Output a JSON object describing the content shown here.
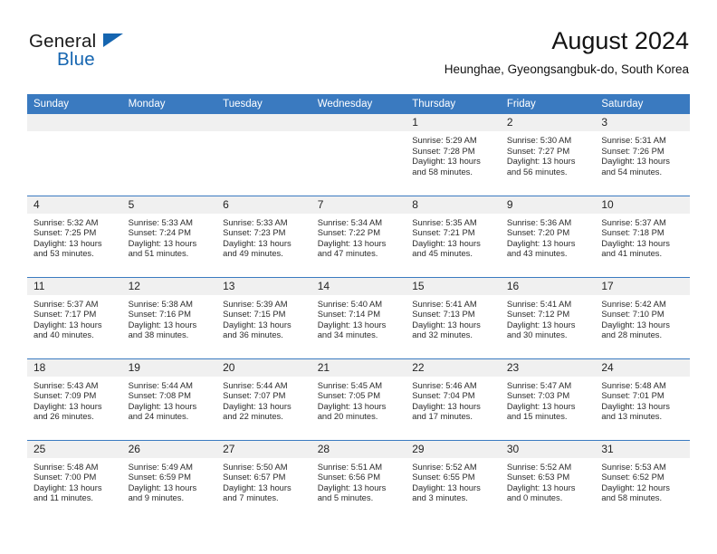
{
  "brand": {
    "name_part1": "General",
    "name_part2": "Blue",
    "accent_color": "#1565b0",
    "logo_icon": "triangle-logo-icon"
  },
  "header": {
    "title": "August 2024",
    "subtitle": "Heunghae, Gyeongsangbuk-do, South Korea"
  },
  "calendar": {
    "header_bg": "#3a7ac0",
    "daynum_bg": "#f0f0f0",
    "weekday_headers": [
      "Sunday",
      "Monday",
      "Tuesday",
      "Wednesday",
      "Thursday",
      "Friday",
      "Saturday"
    ],
    "weeks": [
      [
        {
          "day": "",
          "sunrise": "",
          "sunset": "",
          "daylight_line1": "",
          "daylight_line2": "",
          "empty": true
        },
        {
          "day": "",
          "sunrise": "",
          "sunset": "",
          "daylight_line1": "",
          "daylight_line2": "",
          "empty": true
        },
        {
          "day": "",
          "sunrise": "",
          "sunset": "",
          "daylight_line1": "",
          "daylight_line2": "",
          "empty": true
        },
        {
          "day": "",
          "sunrise": "",
          "sunset": "",
          "daylight_line1": "",
          "daylight_line2": "",
          "empty": true
        },
        {
          "day": "1",
          "sunrise": "Sunrise: 5:29 AM",
          "sunset": "Sunset: 7:28 PM",
          "daylight_line1": "Daylight: 13 hours",
          "daylight_line2": "and 58 minutes."
        },
        {
          "day": "2",
          "sunrise": "Sunrise: 5:30 AM",
          "sunset": "Sunset: 7:27 PM",
          "daylight_line1": "Daylight: 13 hours",
          "daylight_line2": "and 56 minutes."
        },
        {
          "day": "3",
          "sunrise": "Sunrise: 5:31 AM",
          "sunset": "Sunset: 7:26 PM",
          "daylight_line1": "Daylight: 13 hours",
          "daylight_line2": "and 54 minutes."
        }
      ],
      [
        {
          "day": "4",
          "sunrise": "Sunrise: 5:32 AM",
          "sunset": "Sunset: 7:25 PM",
          "daylight_line1": "Daylight: 13 hours",
          "daylight_line2": "and 53 minutes."
        },
        {
          "day": "5",
          "sunrise": "Sunrise: 5:33 AM",
          "sunset": "Sunset: 7:24 PM",
          "daylight_line1": "Daylight: 13 hours",
          "daylight_line2": "and 51 minutes."
        },
        {
          "day": "6",
          "sunrise": "Sunrise: 5:33 AM",
          "sunset": "Sunset: 7:23 PM",
          "daylight_line1": "Daylight: 13 hours",
          "daylight_line2": "and 49 minutes."
        },
        {
          "day": "7",
          "sunrise": "Sunrise: 5:34 AM",
          "sunset": "Sunset: 7:22 PM",
          "daylight_line1": "Daylight: 13 hours",
          "daylight_line2": "and 47 minutes."
        },
        {
          "day": "8",
          "sunrise": "Sunrise: 5:35 AM",
          "sunset": "Sunset: 7:21 PM",
          "daylight_line1": "Daylight: 13 hours",
          "daylight_line2": "and 45 minutes."
        },
        {
          "day": "9",
          "sunrise": "Sunrise: 5:36 AM",
          "sunset": "Sunset: 7:20 PM",
          "daylight_line1": "Daylight: 13 hours",
          "daylight_line2": "and 43 minutes."
        },
        {
          "day": "10",
          "sunrise": "Sunrise: 5:37 AM",
          "sunset": "Sunset: 7:18 PM",
          "daylight_line1": "Daylight: 13 hours",
          "daylight_line2": "and 41 minutes."
        }
      ],
      [
        {
          "day": "11",
          "sunrise": "Sunrise: 5:37 AM",
          "sunset": "Sunset: 7:17 PM",
          "daylight_line1": "Daylight: 13 hours",
          "daylight_line2": "and 40 minutes."
        },
        {
          "day": "12",
          "sunrise": "Sunrise: 5:38 AM",
          "sunset": "Sunset: 7:16 PM",
          "daylight_line1": "Daylight: 13 hours",
          "daylight_line2": "and 38 minutes."
        },
        {
          "day": "13",
          "sunrise": "Sunrise: 5:39 AM",
          "sunset": "Sunset: 7:15 PM",
          "daylight_line1": "Daylight: 13 hours",
          "daylight_line2": "and 36 minutes."
        },
        {
          "day": "14",
          "sunrise": "Sunrise: 5:40 AM",
          "sunset": "Sunset: 7:14 PM",
          "daylight_line1": "Daylight: 13 hours",
          "daylight_line2": "and 34 minutes."
        },
        {
          "day": "15",
          "sunrise": "Sunrise: 5:41 AM",
          "sunset": "Sunset: 7:13 PM",
          "daylight_line1": "Daylight: 13 hours",
          "daylight_line2": "and 32 minutes."
        },
        {
          "day": "16",
          "sunrise": "Sunrise: 5:41 AM",
          "sunset": "Sunset: 7:12 PM",
          "daylight_line1": "Daylight: 13 hours",
          "daylight_line2": "and 30 minutes."
        },
        {
          "day": "17",
          "sunrise": "Sunrise: 5:42 AM",
          "sunset": "Sunset: 7:10 PM",
          "daylight_line1": "Daylight: 13 hours",
          "daylight_line2": "and 28 minutes."
        }
      ],
      [
        {
          "day": "18",
          "sunrise": "Sunrise: 5:43 AM",
          "sunset": "Sunset: 7:09 PM",
          "daylight_line1": "Daylight: 13 hours",
          "daylight_line2": "and 26 minutes."
        },
        {
          "day": "19",
          "sunrise": "Sunrise: 5:44 AM",
          "sunset": "Sunset: 7:08 PM",
          "daylight_line1": "Daylight: 13 hours",
          "daylight_line2": "and 24 minutes."
        },
        {
          "day": "20",
          "sunrise": "Sunrise: 5:44 AM",
          "sunset": "Sunset: 7:07 PM",
          "daylight_line1": "Daylight: 13 hours",
          "daylight_line2": "and 22 minutes."
        },
        {
          "day": "21",
          "sunrise": "Sunrise: 5:45 AM",
          "sunset": "Sunset: 7:05 PM",
          "daylight_line1": "Daylight: 13 hours",
          "daylight_line2": "and 20 minutes."
        },
        {
          "day": "22",
          "sunrise": "Sunrise: 5:46 AM",
          "sunset": "Sunset: 7:04 PM",
          "daylight_line1": "Daylight: 13 hours",
          "daylight_line2": "and 17 minutes."
        },
        {
          "day": "23",
          "sunrise": "Sunrise: 5:47 AM",
          "sunset": "Sunset: 7:03 PM",
          "daylight_line1": "Daylight: 13 hours",
          "daylight_line2": "and 15 minutes."
        },
        {
          "day": "24",
          "sunrise": "Sunrise: 5:48 AM",
          "sunset": "Sunset: 7:01 PM",
          "daylight_line1": "Daylight: 13 hours",
          "daylight_line2": "and 13 minutes."
        }
      ],
      [
        {
          "day": "25",
          "sunrise": "Sunrise: 5:48 AM",
          "sunset": "Sunset: 7:00 PM",
          "daylight_line1": "Daylight: 13 hours",
          "daylight_line2": "and 11 minutes."
        },
        {
          "day": "26",
          "sunrise": "Sunrise: 5:49 AM",
          "sunset": "Sunset: 6:59 PM",
          "daylight_line1": "Daylight: 13 hours",
          "daylight_line2": "and 9 minutes."
        },
        {
          "day": "27",
          "sunrise": "Sunrise: 5:50 AM",
          "sunset": "Sunset: 6:57 PM",
          "daylight_line1": "Daylight: 13 hours",
          "daylight_line2": "and 7 minutes."
        },
        {
          "day": "28",
          "sunrise": "Sunrise: 5:51 AM",
          "sunset": "Sunset: 6:56 PM",
          "daylight_line1": "Daylight: 13 hours",
          "daylight_line2": "and 5 minutes."
        },
        {
          "day": "29",
          "sunrise": "Sunrise: 5:52 AM",
          "sunset": "Sunset: 6:55 PM",
          "daylight_line1": "Daylight: 13 hours",
          "daylight_line2": "and 3 minutes."
        },
        {
          "day": "30",
          "sunrise": "Sunrise: 5:52 AM",
          "sunset": "Sunset: 6:53 PM",
          "daylight_line1": "Daylight: 13 hours",
          "daylight_line2": "and 0 minutes."
        },
        {
          "day": "31",
          "sunrise": "Sunrise: 5:53 AM",
          "sunset": "Sunset: 6:52 PM",
          "daylight_line1": "Daylight: 12 hours",
          "daylight_line2": "and 58 minutes."
        }
      ]
    ]
  }
}
